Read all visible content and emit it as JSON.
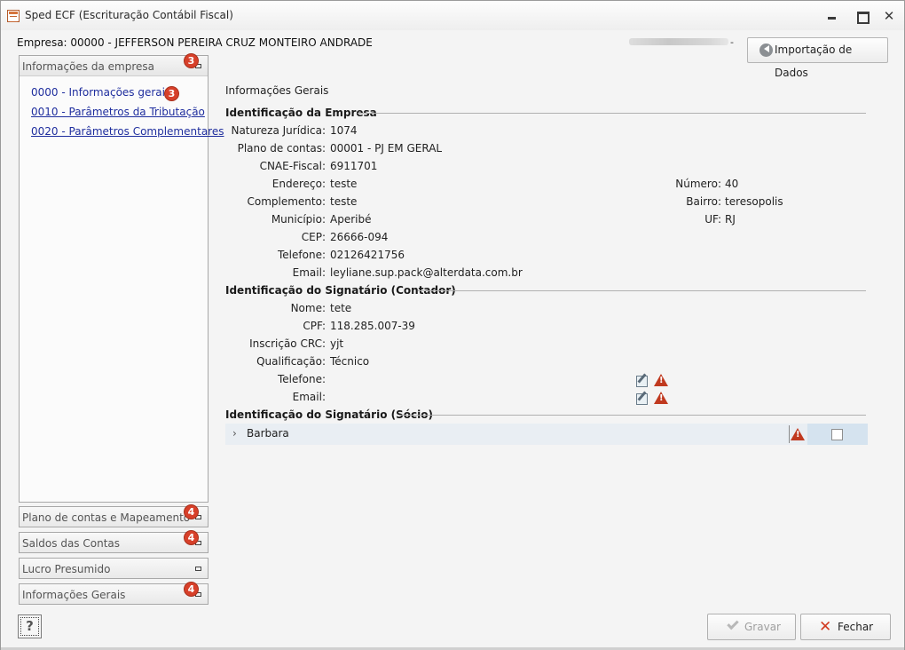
{
  "window": {
    "title": "Sped ECF (Escrituração Contábil Fiscal)",
    "icons": {
      "app": "spreadsheet-icon",
      "minimize": "minimize-icon",
      "maximize": "maximize-icon",
      "close": "close-icon",
      "close_glyph": "✕"
    }
  },
  "header": {
    "company": "Empresa: 00000 - JEFFERSON PEREIRA CRUZ MONTEIRO ANDRADE",
    "user_suffix": "-",
    "import_button": "Importação de Dados"
  },
  "sidebar": {
    "main_panel": {
      "label": "Informações da empresa",
      "badge": "3",
      "items": [
        {
          "label": "0000 - Informações gerais",
          "badge": "3"
        },
        {
          "label": "0010 - Parâmetros da Tributação"
        },
        {
          "label": "0020 - Parâmetros Complementares"
        }
      ]
    },
    "panels": [
      {
        "label": "Plano de contas e Mapeamento",
        "badge": "4"
      },
      {
        "label": "Saldos das Contas",
        "badge": "4"
      },
      {
        "label": "Lucro Presumido",
        "badge": ""
      },
      {
        "label": "Informações Gerais",
        "badge": "4"
      }
    ],
    "help": "?"
  },
  "content": {
    "title": "Informações Gerais",
    "empresa": {
      "heading": "Identificação da Empresa",
      "natureza_label": "Natureza Jurídica:",
      "natureza": "1074",
      "plano_label": "Plano de contas:",
      "plano": "00001 - PJ EM GERAL",
      "cnae_label": "CNAE-Fiscal:",
      "cnae": "6911701",
      "endereco_label": "Endereço:",
      "endereco": "teste",
      "numero_label": "Número:",
      "numero": "40",
      "complemento_label": "Complemento:",
      "complemento": "teste",
      "bairro_label": "Bairro:",
      "bairro": "teresopolis",
      "municipio_label": "Município:",
      "municipio": "Aperibé",
      "uf_label": "UF:",
      "uf": "RJ",
      "cep_label": "CEP:",
      "cep": "26666-094",
      "telefone_label": "Telefone:",
      "telefone": "02126421756",
      "email_label": "Email:",
      "email": "leyliane.sup.pack@alterdata.com.br"
    },
    "contador": {
      "heading": "Identificação do Signatário (Contador)",
      "nome_label": "Nome:",
      "nome": "tete",
      "cpf_label": "CPF:",
      "cpf": "118.285.007-39",
      "crc_label": "Inscrição CRC:",
      "crc": "yjt",
      "qualificacao_label": "Qualificação:",
      "qualificacao": "Técnico",
      "telefone_label": "Telefone:",
      "email_label": "Email:"
    },
    "socio": {
      "heading": "Identificação do Signatário (Sócio)",
      "rows": [
        {
          "name": "Barbara",
          "chevron": "›"
        }
      ]
    }
  },
  "footer": {
    "save_button": "Gravar",
    "close_button": "Fechar"
  }
}
